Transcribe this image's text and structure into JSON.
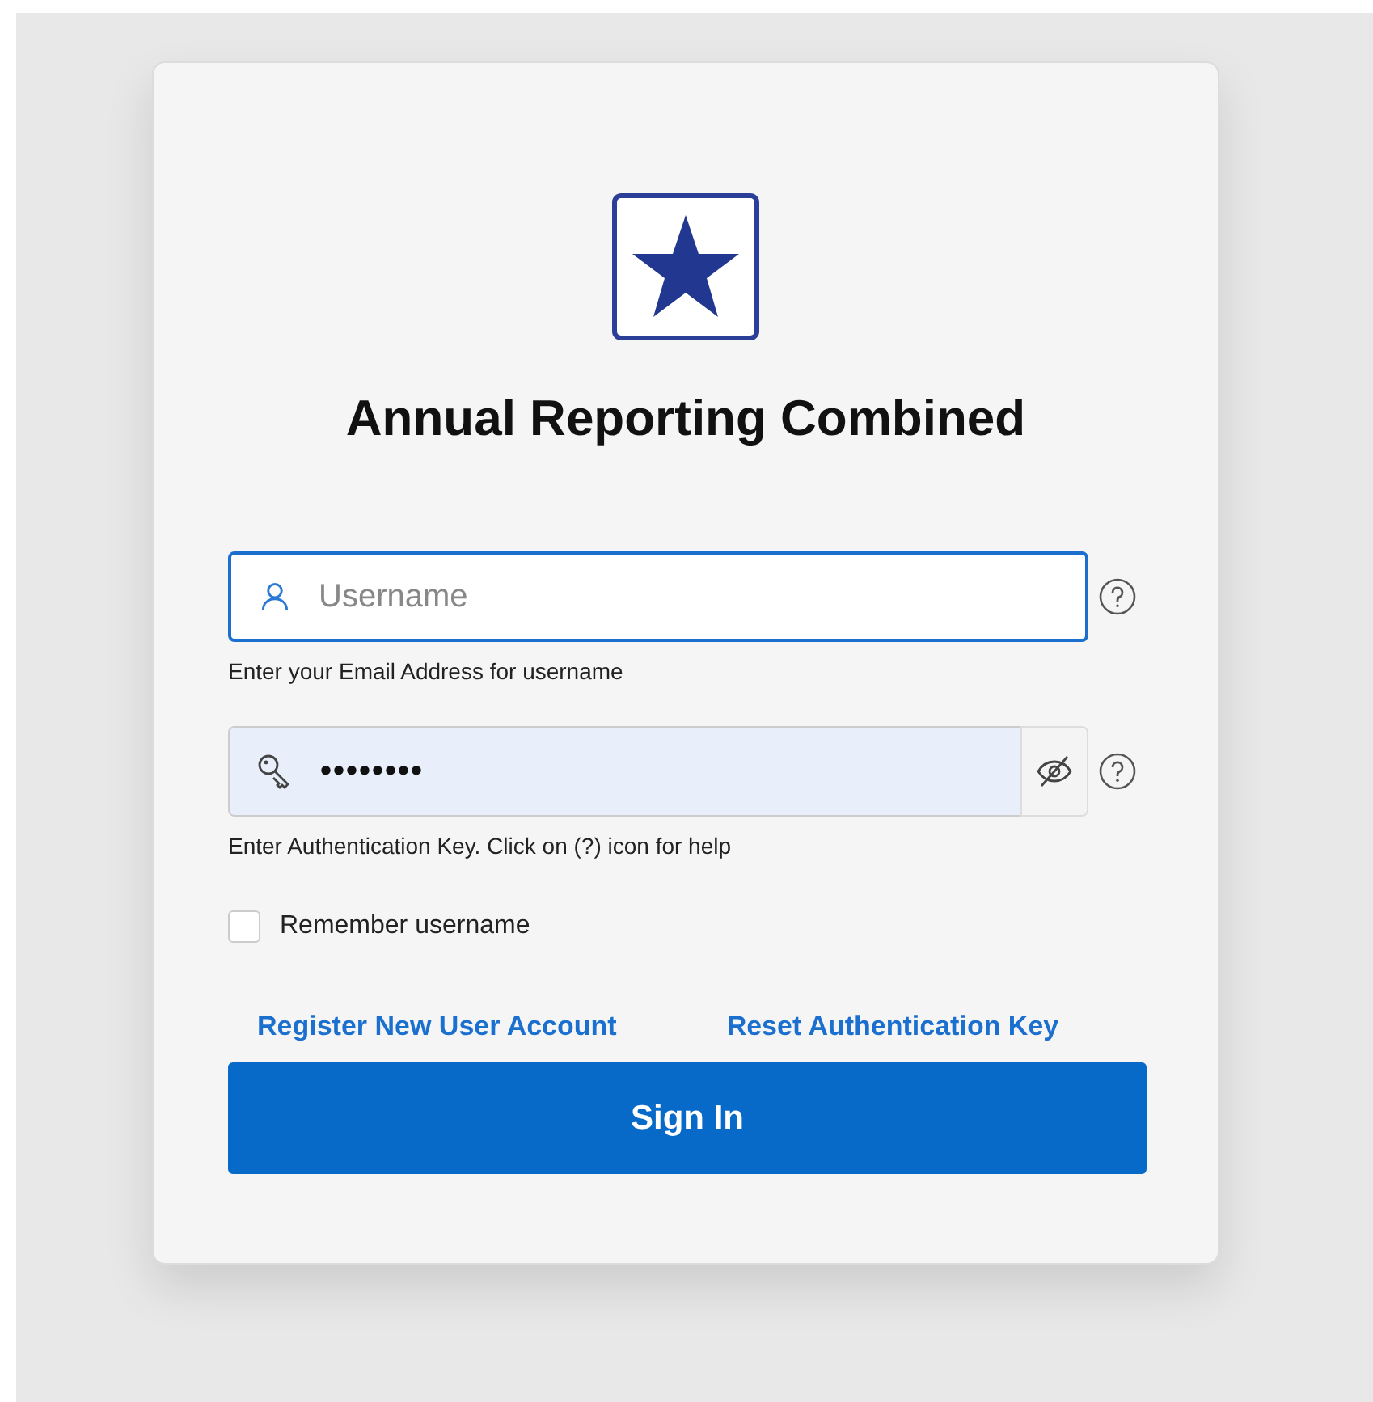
{
  "app": {
    "title": "Annual Reporting Combined"
  },
  "username": {
    "placeholder": "Username",
    "focused": true,
    "hint": "Enter your Email Address for username"
  },
  "password": {
    "value": "••••••••",
    "focused": false,
    "hint": "Enter Authentication Key. Click on (?) icon for help"
  },
  "remember": {
    "label": "Remember username",
    "checked": false
  },
  "links": [
    "Register New User Account",
    "Reset Authentication Key"
  ],
  "sign_in": {
    "label": "Sign In"
  }
}
